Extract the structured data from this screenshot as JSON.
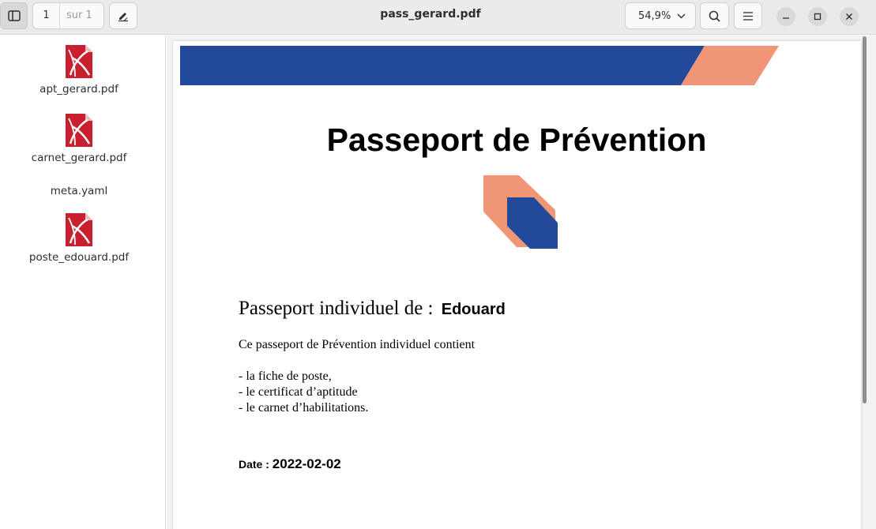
{
  "header": {
    "title": "pass_gerard.pdf",
    "page_current": "1",
    "page_total": "sur 1",
    "zoom": "54,9%",
    "icons": {
      "sidebar_toggle": "sidebar-toggle-icon",
      "annotate": "pencil-icon",
      "zoom_dropdown": "chevron-down-icon",
      "search": "search-icon",
      "menu": "hamburger-menu-icon",
      "minimize": "minimize-icon",
      "maximize": "maximize-icon",
      "close": "close-icon"
    }
  },
  "sidebar": {
    "files": [
      {
        "name": "apt_gerard.pdf",
        "icon": "pdf-file-icon"
      },
      {
        "name": "carnet_gerard.pdf",
        "icon": "pdf-file-icon"
      },
      {
        "name": "meta.yaml",
        "icon": ""
      },
      {
        "name": "poste_edouard.pdf",
        "icon": "pdf-file-icon"
      }
    ]
  },
  "document": {
    "title": "Passeport de Prévention",
    "passport_label": "Passeport individuel de :",
    "passport_name": "Edouard",
    "intro": "Ce passeport de Prévention individuel contient",
    "items": [
      "- la fiche de poste,",
      "- le certificat d’aptitude",
      "- le carnet d’habilitations."
    ],
    "date_label": "Date : ",
    "date_value": "2022-02-02"
  },
  "colors": {
    "banner_blue": "#234a9a",
    "banner_salmon": "#f09575",
    "pdf_icon_red": "#c8202e"
  }
}
